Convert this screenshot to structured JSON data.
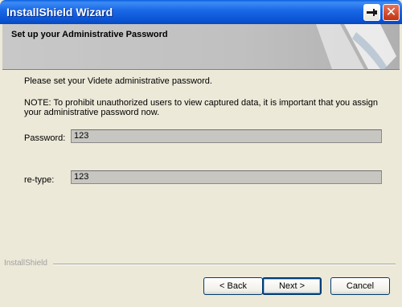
{
  "window": {
    "title": "InstallShield Wizard"
  },
  "banner": {
    "title": "Set up your Administrative Password"
  },
  "body": {
    "instruction": "Please set your Videte administrative password.",
    "note_line1": "NOTE: To prohibit unauthorized users to view captured data, it is important that you assign",
    "note_line2": "your administrative password now."
  },
  "form": {
    "password_label": "Password:",
    "password_value": "123",
    "retype_label": "re-type:",
    "retype_value": "123"
  },
  "footer": {
    "brand": "InstallShield"
  },
  "buttons": {
    "back": "< Back",
    "next": "Next >",
    "cancel": "Cancel"
  },
  "icons": {
    "restore": "restore-icon",
    "close": "close-icon"
  }
}
